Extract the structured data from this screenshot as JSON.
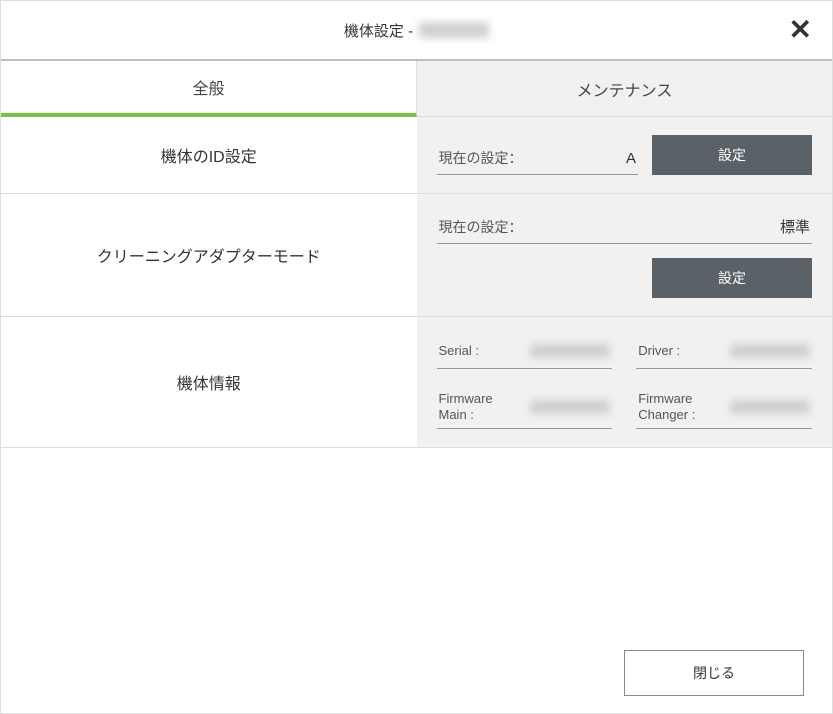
{
  "titlebar": {
    "title_prefix": "機体設定 - "
  },
  "tabs": {
    "general": "全般",
    "maintenance": "メンテナンス"
  },
  "rows": {
    "id_setting": {
      "label": "機体のID設定",
      "current_label": "現在の設定：",
      "current_value": "A",
      "button": "設定"
    },
    "cleaning_mode": {
      "label": "クリーニングアダプターモード",
      "current_label": "現在の設定：",
      "current_value": "標準",
      "button": "設定"
    },
    "machine_info": {
      "label": "機体情報",
      "serial_label": "Serial :",
      "driver_label": "Driver :",
      "fw_main_label": "Firmware\nMain :",
      "fw_changer_label": "Firmware\nChanger :"
    }
  },
  "footer": {
    "close": "閉じる"
  }
}
